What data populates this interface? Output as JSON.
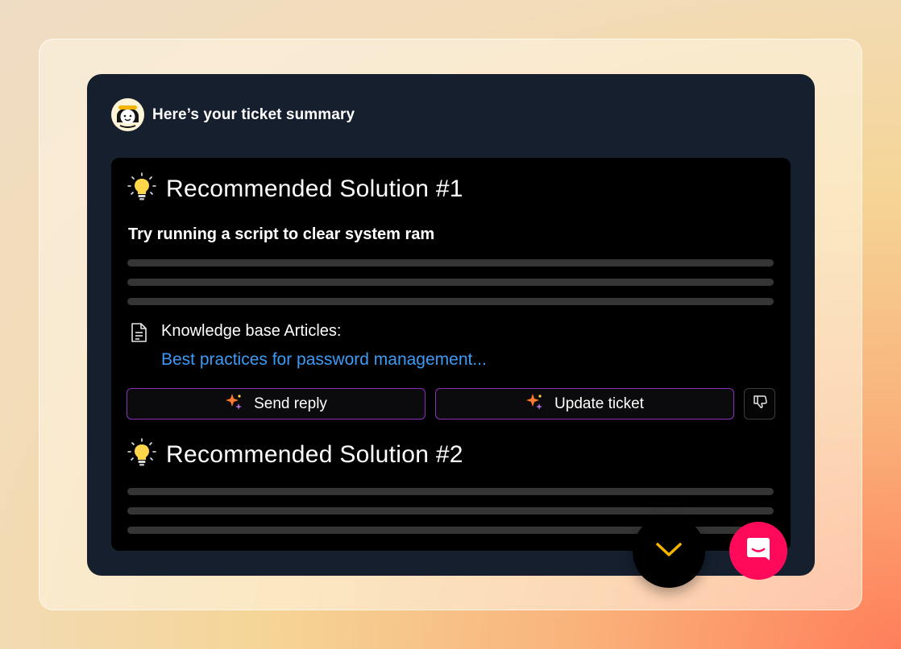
{
  "header": {
    "title": "Here’s your ticket summary",
    "avatar_icon": "assistant-avatar"
  },
  "solutions": [
    {
      "title": "Recommended Solution #1",
      "subtitle": "Try running a script to clear system ram",
      "icon": "lightbulb-icon",
      "knowledge_base": {
        "heading": "Knowledge base Articles:",
        "link": "Best practices for password management..."
      },
      "actions": {
        "send_reply": "Send reply",
        "update_ticket": "Update ticket",
        "thumbs_down_icon": "thumbs-down-icon"
      }
    },
    {
      "title": "Recommended Solution #2",
      "icon": "lightbulb-icon"
    }
  ],
  "floating": {
    "scroll_icon": "chevron-down-icon",
    "chat_icon": "chat-icon"
  },
  "colors": {
    "panel": "#151f2e",
    "card": "#000000",
    "link": "#3d9bf5",
    "button_border": "#8a2fb8",
    "chat_button": "#ff0a5a",
    "chevron": "#f5b400"
  }
}
